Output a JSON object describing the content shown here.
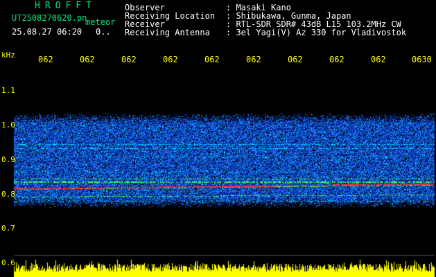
{
  "brand": "HROFFT",
  "filename": "UT2508270620.pn",
  "mode": "meteor",
  "datetime": "25.08.27 06:20",
  "counter": "0..",
  "info": {
    "observer_label": "Observer",
    "observer_value": ": Masaki Kano",
    "location_label": "Receiving Location",
    "location_value": ": Shibukawa, Gunma, Japan",
    "receiver_label": "Receiver",
    "receiver_value": ": RTL-SDR SDR# 43dB L15 103.2MHz CW",
    "antenna_label": "Receiving Antenna",
    "antenna_value": ": 3el Yagi(V) Az 330 for Vladivostok"
  },
  "y_axis": {
    "unit": "kHz",
    "ticks": [
      "1.1",
      "1.0",
      "0.9",
      "0.8",
      "0.7",
      "0.6"
    ]
  },
  "x_axis": {
    "ticks": [
      "062",
      "062",
      "062",
      "062",
      "062",
      "062",
      "062",
      "062",
      "062",
      "0630"
    ]
  },
  "colors": {
    "background": "#000000",
    "noise_low": "#0a2aa8",
    "noise_mid": "#1e7bff",
    "signal_cyan": "#00e5ff",
    "signal_green": "#3cff5a",
    "signal_red": "#ff2a2a",
    "level_bar": "#ffff00",
    "axis_text": "#ffff00"
  }
}
